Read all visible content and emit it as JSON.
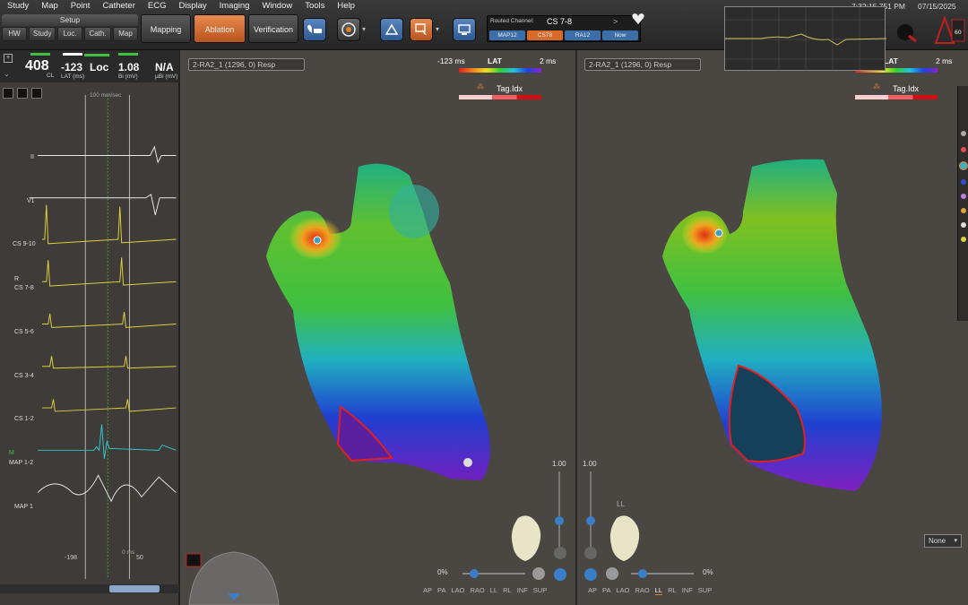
{
  "menu": [
    "Study",
    "Map",
    "Point",
    "Catheter",
    "ECG",
    "Display",
    "Imaging",
    "Window",
    "Tools",
    "Help"
  ],
  "setup": {
    "label": "Setup",
    "tabs": [
      "HW",
      "Study",
      "Loc.",
      "Cath.",
      "Map"
    ]
  },
  "modes": {
    "mapping": "Mapping",
    "ablation": "Ablation",
    "verification": "Verification"
  },
  "routed": {
    "title": "Routed Channel:",
    "value": "CS 7-8",
    "arrow": ">",
    "tabs": [
      "MAP12",
      "CS78",
      "RA12",
      "Now"
    ]
  },
  "clock": "7:32:15.751 PM",
  "date": "07/15/2025",
  "stats": [
    {
      "value": "408",
      "label": "CL",
      "bar": "#40c040"
    },
    {
      "value": "-123",
      "label": "LAT (ms)",
      "bar": "#ffffff"
    },
    {
      "value": "Loc",
      "label": "",
      "bar": "#222222"
    },
    {
      "value": "1.08",
      "label": "Bi (mV)",
      "bar": "#40c040"
    },
    {
      "value": "N/A",
      "label": "µBi (mV)",
      "bar": "#222222"
    }
  ],
  "sweep": "100 mm/sec",
  "channels": [
    {
      "name": "II",
      "color": "#e8e8e8"
    },
    {
      "name": "V1",
      "color": "#e8e8e8"
    },
    {
      "name": "CS 9-10",
      "color": "#e0d040"
    },
    {
      "name": "CS 7-8",
      "color": "#e0d040"
    },
    {
      "name": "CS 5-6",
      "color": "#e0d040"
    },
    {
      "name": "CS 3-4",
      "color": "#e0d040"
    },
    {
      "name": "CS 1-2",
      "color": "#e0d040"
    },
    {
      "name": "MAP 1-2",
      "color": "#30c8d0"
    },
    {
      "name": "MAP 1",
      "color": "#e8e8e8"
    }
  ],
  "markers": {
    "left": "-198",
    "center": "0 ms",
    "right": "50",
    "r_marker": "R",
    "m_marker": "M"
  },
  "viewL": {
    "select": "2-RA2_1 (1296, 0) Resp",
    "lat_min": "-123 ms",
    "lat_label": "LAT",
    "lat_max": "2 ms",
    "tag_label": "Tag.Idx",
    "scale": "1.00",
    "zoom_pct": "0%"
  },
  "viewR": {
    "select": "2-RA2_1 (1296, 0) Resp",
    "lat_label": "LAT",
    "lat_max": "2 ms",
    "tag_label": "Tag.Idx",
    "scale": "1.00",
    "zoom_pct": "0%",
    "view_tag": "LL"
  },
  "orientations": [
    "AP",
    "PA",
    "LAO",
    "RAO",
    "LL",
    "RL",
    "INF",
    "SUP"
  ],
  "none_select": "None",
  "colors": {
    "ablation": "#d8692e",
    "accent_blue": "#3c6ea8"
  }
}
